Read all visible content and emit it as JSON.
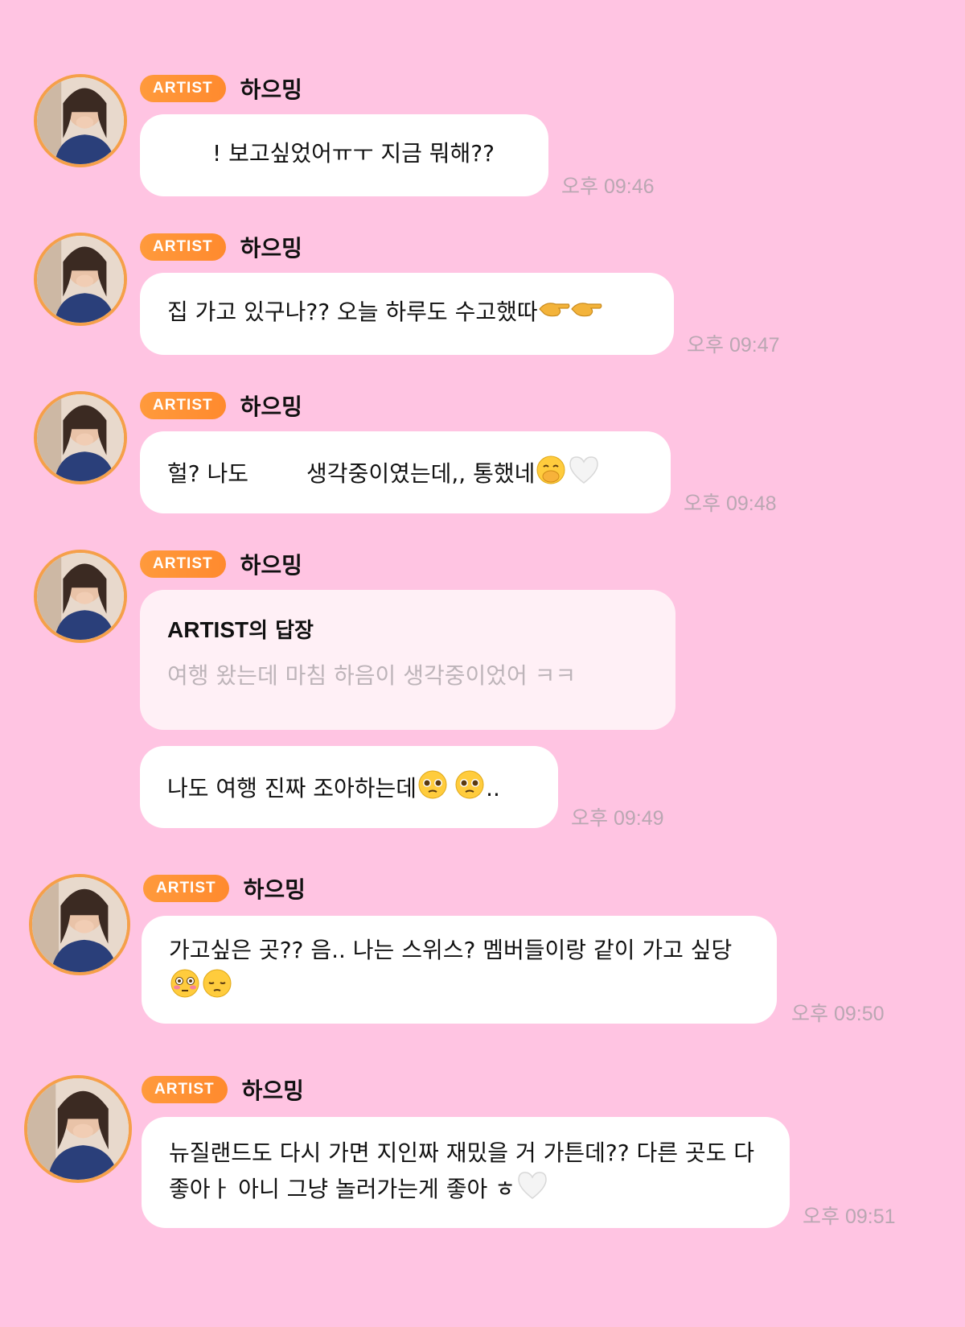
{
  "badge_label": "ARTIST",
  "sender_name": "하으밍",
  "messages": [
    {
      "text": "! 보고싶었어ㅠㅜ 지금 뭐해??",
      "time": "오후 09:46"
    },
    {
      "text": "집 가고 있구나?? 오늘 하루도 수고했따",
      "emojis": [
        "hand-pointing-icon",
        "hand-pointing-icon"
      ],
      "time": "오후 09:47"
    },
    {
      "text_before": "헐? 나도",
      "text_after": "생각중이였는데,, 통했네",
      "emojis": [
        "hand-over-mouth-icon",
        "white-heart-icon"
      ],
      "time": "오후 09:48"
    },
    {
      "reply_label_strong": "ARTIST",
      "reply_label_rest": "의 답장",
      "reply_text": "여행 왔는데 마침 하음이 생각중이었어 ㅋㅋ",
      "text": "나도 여행 진짜 조아하는데",
      "emojis": [
        "pleading-face-icon",
        "pleading-face-icon"
      ],
      "text_after": "..",
      "time": "오후 09:49"
    },
    {
      "text": "가고싶은 곳?? 음.. 나는 스위스? 멤버들이랑 같이 가고 싶당",
      "emojis": [
        "flushed-face-icon",
        "pensive-face-icon"
      ],
      "time": "오후 09:50"
    },
    {
      "text": "뉴질랜드도 다시 가면 지인짜 재밌을 거 가튼데?? 다른 곳도 다 좋아ㅏ 아니 그냥 놀러가는게 좋아 ㅎ",
      "emojis": [
        "white-heart-icon"
      ],
      "time": "오후 09:51"
    }
  ],
  "colors": {
    "background": "#ffc4e2",
    "badge": "#ff9a3c",
    "avatar_ring": "#f5a04a",
    "time": "#b9a7b2"
  }
}
